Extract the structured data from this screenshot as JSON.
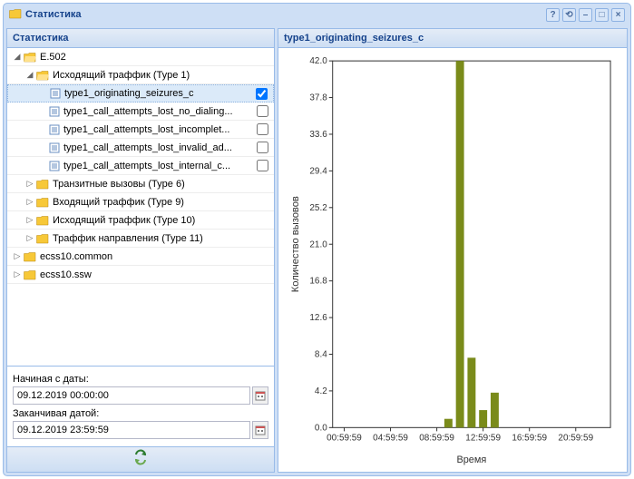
{
  "window": {
    "title": "Статистика"
  },
  "sidebar": {
    "header": "Статистика",
    "date_from_label": "Начиная с даты:",
    "date_from_value": "09.12.2019 00:00:00",
    "date_to_label": "Заканчивая датой:",
    "date_to_value": "09.12.2019 23:59:59"
  },
  "tree": {
    "n0": {
      "label": "E.502"
    },
    "n1": {
      "label": "Исходящий траффик (Type 1)"
    },
    "n2": {
      "label": "type1_originating_seizures_c"
    },
    "n3": {
      "label": "type1_call_attempts_lost_no_dialing..."
    },
    "n4": {
      "label": "type1_call_attempts_lost_incomplet..."
    },
    "n5": {
      "label": "type1_call_attempts_lost_invalid_ad..."
    },
    "n6": {
      "label": "type1_call_attempts_lost_internal_c..."
    },
    "n7": {
      "label": "Транзитные вызовы (Type 6)"
    },
    "n8": {
      "label": "Входящий траффик (Type 9)"
    },
    "n9": {
      "label": "Исходящий траффик (Type 10)"
    },
    "n10": {
      "label": "Траффик направления (Type 11)"
    },
    "n11": {
      "label": "ecss10.common"
    },
    "n12": {
      "label": "ecss10.ssw"
    }
  },
  "chart_title": "type1_originating_seizures_c",
  "chart_data": {
    "type": "bar",
    "title": "type1_originating_seizures_c",
    "xlabel": "Время",
    "ylabel": "Количество вызовов",
    "ylim": [
      0,
      42
    ],
    "x_ticks": [
      "00:59:59",
      "04:59:59",
      "08:59:59",
      "12:59:59",
      "16:59:59",
      "20:59:59"
    ],
    "y_ticks": [
      0.0,
      4.2,
      8.4,
      12.6,
      16.8,
      21.0,
      25.2,
      29.4,
      33.6,
      37.8,
      42.0
    ],
    "points": [
      {
        "x_hour": 10,
        "value": 1
      },
      {
        "x_hour": 11,
        "value": 42
      },
      {
        "x_hour": 12,
        "value": 8
      },
      {
        "x_hour": 13,
        "value": 2
      },
      {
        "x_hour": 14,
        "value": 4
      }
    ]
  }
}
